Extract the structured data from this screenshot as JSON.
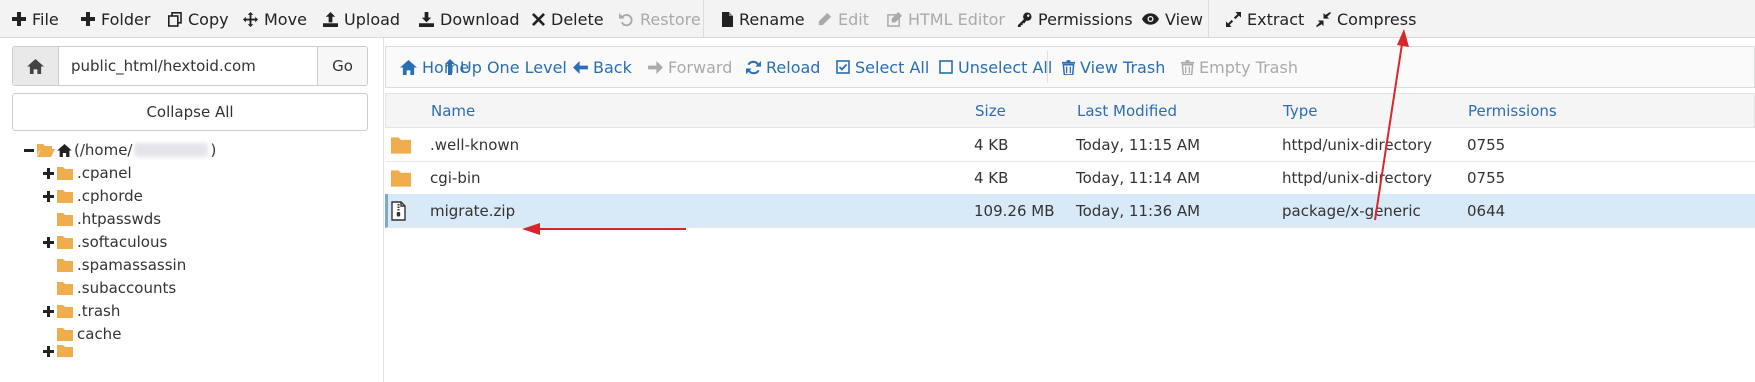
{
  "toolbar": {
    "items": [
      {
        "label": "File",
        "icon": "plus-icon",
        "enabled": true
      },
      {
        "label": "Folder",
        "icon": "plus-icon",
        "enabled": true
      },
      {
        "label": "Copy",
        "icon": "copy-icon",
        "enabled": true
      },
      {
        "label": "Move",
        "icon": "move-icon",
        "enabled": true
      },
      {
        "label": "Upload",
        "icon": "upload-icon",
        "enabled": true
      },
      {
        "label": "Download",
        "icon": "download-icon",
        "enabled": true
      },
      {
        "label": "Delete",
        "icon": "close-icon",
        "enabled": true
      },
      {
        "label": "Restore",
        "icon": "undo-icon",
        "enabled": false
      },
      {
        "label": "Rename",
        "icon": "file-icon",
        "enabled": true
      },
      {
        "label": "Edit",
        "icon": "pencil-icon",
        "enabled": false
      },
      {
        "label": "HTML Editor",
        "icon": "edit-square-icon",
        "enabled": false
      },
      {
        "label": "Permissions",
        "icon": "key-icon",
        "enabled": true
      },
      {
        "label": "View",
        "icon": "eye-icon",
        "enabled": true
      },
      {
        "label": "Extract",
        "icon": "expand-icon",
        "enabled": true
      },
      {
        "label": "Compress",
        "icon": "compress-icon",
        "enabled": true
      }
    ]
  },
  "sidebar": {
    "path_value": "public_html/hextoid.com",
    "go_label": "Go",
    "collapse_label": "Collapse All",
    "root_label_prefix": "(/home/",
    "root_label_suffix": ")",
    "tree": [
      {
        "label": ".cpanel",
        "expandable": true
      },
      {
        "label": ".cphorde",
        "expandable": true
      },
      {
        "label": ".htpasswds",
        "expandable": false
      },
      {
        "label": ".softaculous",
        "expandable": true
      },
      {
        "label": ".spamassassin",
        "expandable": false
      },
      {
        "label": ".subaccounts",
        "expandable": false
      },
      {
        "label": ".trash",
        "expandable": true
      },
      {
        "label": "cache",
        "expandable": false
      }
    ]
  },
  "actionbar": {
    "items": [
      {
        "label": "Home",
        "icon": "home-icon",
        "enabled": true
      },
      {
        "label": "Up One Level",
        "icon": "level-up-icon",
        "enabled": true
      },
      {
        "label": "Back",
        "icon": "arrow-left-icon",
        "enabled": true
      },
      {
        "label": "Forward",
        "icon": "arrow-right-icon",
        "enabled": false
      },
      {
        "label": "Reload",
        "icon": "refresh-icon",
        "enabled": true
      },
      {
        "label": "Select All",
        "icon": "checkbox-checked-icon",
        "enabled": true
      },
      {
        "label": "Unselect All",
        "icon": "checkbox-empty-icon",
        "enabled": true
      },
      {
        "label": "View Trash",
        "icon": "trash-icon",
        "enabled": true
      },
      {
        "label": "Empty Trash",
        "icon": "trash-icon",
        "enabled": false
      }
    ]
  },
  "table": {
    "columns": [
      "Name",
      "Size",
      "Last Modified",
      "Type",
      "Permissions"
    ],
    "rows": [
      {
        "icon": "folder-icon",
        "name": ".well-known",
        "size": "4 KB",
        "modified": "Today, 11:15 AM",
        "type": "httpd/unix-directory",
        "perms": "0755",
        "selected": false
      },
      {
        "icon": "folder-icon",
        "name": "cgi-bin",
        "size": "4 KB",
        "modified": "Today, 11:14 AM",
        "type": "httpd/unix-directory",
        "perms": "0755",
        "selected": false
      },
      {
        "icon": "zip-file-icon",
        "name": "migrate.zip",
        "size": "109.26 MB",
        "modified": "Today, 11:36 AM",
        "type": "package/x-generic",
        "perms": "0644",
        "selected": true
      }
    ]
  },
  "colors": {
    "link": "#2a6eb4",
    "folder": "#f0ad4e",
    "selected_row": "#d8eaf8",
    "annotation_arrow": "#d9262c"
  }
}
